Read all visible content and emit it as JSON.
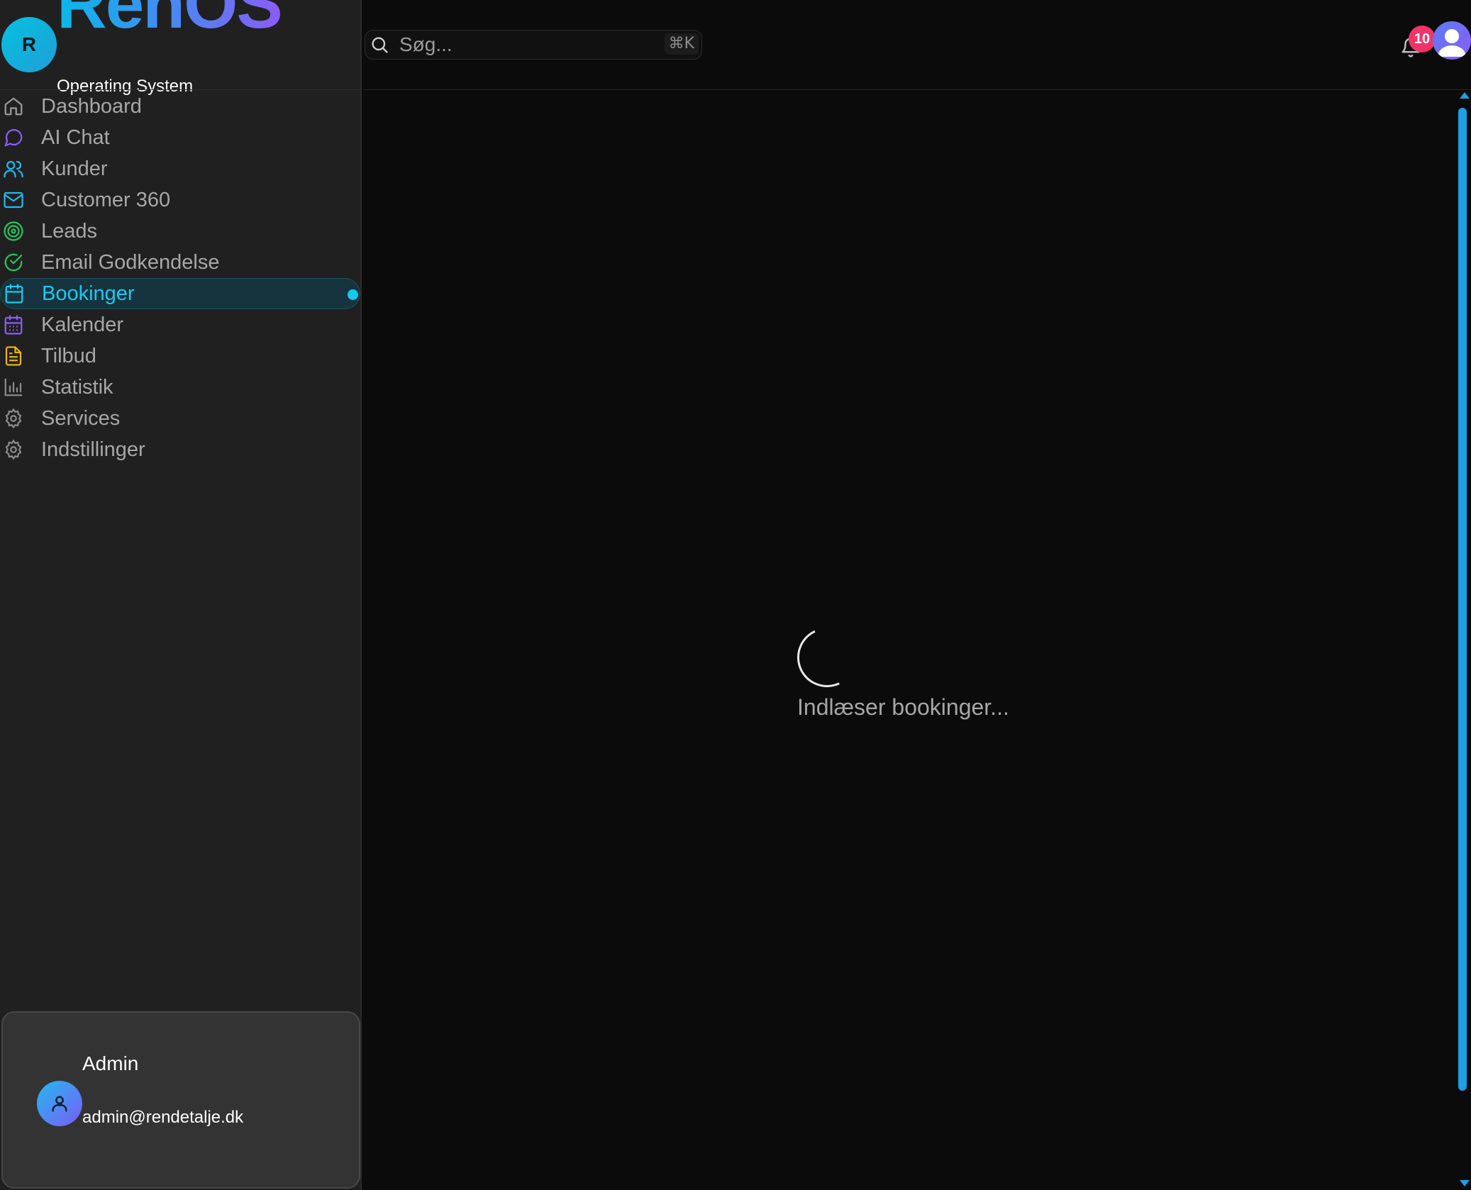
{
  "brand": {
    "logo_letter": "R",
    "name": "RenOS",
    "subtitle": "Operating System"
  },
  "sidebar": {
    "items": [
      {
        "label": "Dashboard",
        "icon": "home-icon",
        "color": "#9a9a9a"
      },
      {
        "label": "AI Chat",
        "icon": "message-circle-icon",
        "color": "#8b5cf6"
      },
      {
        "label": "Kunder",
        "icon": "users-icon",
        "color": "#22b8f0"
      },
      {
        "label": "Customer 360",
        "icon": "mail-icon",
        "color": "#22b8f0"
      },
      {
        "label": "Leads",
        "icon": "target-icon",
        "color": "#22c55e"
      },
      {
        "label": "Email Godkendelse",
        "icon": "check-circle-icon",
        "color": "#22c55e"
      },
      {
        "label": "Bookinger",
        "icon": "calendar-icon",
        "color": "#1ec8f0",
        "active": true
      },
      {
        "label": "Kalender",
        "icon": "calendar-days-icon",
        "color": "#8b5cf6"
      },
      {
        "label": "Tilbud",
        "icon": "file-text-icon",
        "color": "#eab308"
      },
      {
        "label": "Statistik",
        "icon": "bar-chart-icon",
        "color": "#8a8a8a"
      },
      {
        "label": "Services",
        "icon": "gear-icon",
        "color": "#8a8a8a"
      },
      {
        "label": "Indstillinger",
        "icon": "gear-icon",
        "color": "#8a8a8a"
      }
    ]
  },
  "user": {
    "name": "Admin",
    "email": "admin@rendetalje.dk"
  },
  "search": {
    "placeholder": "Søg...",
    "shortcut": "⌘K"
  },
  "notifications": {
    "count": "10"
  },
  "main": {
    "loading_text": "Indlæser bookinger..."
  },
  "colors": {
    "accent": "#1ec8f0",
    "badge": "#f0346a",
    "scrollbar": "#1e9fe6"
  }
}
